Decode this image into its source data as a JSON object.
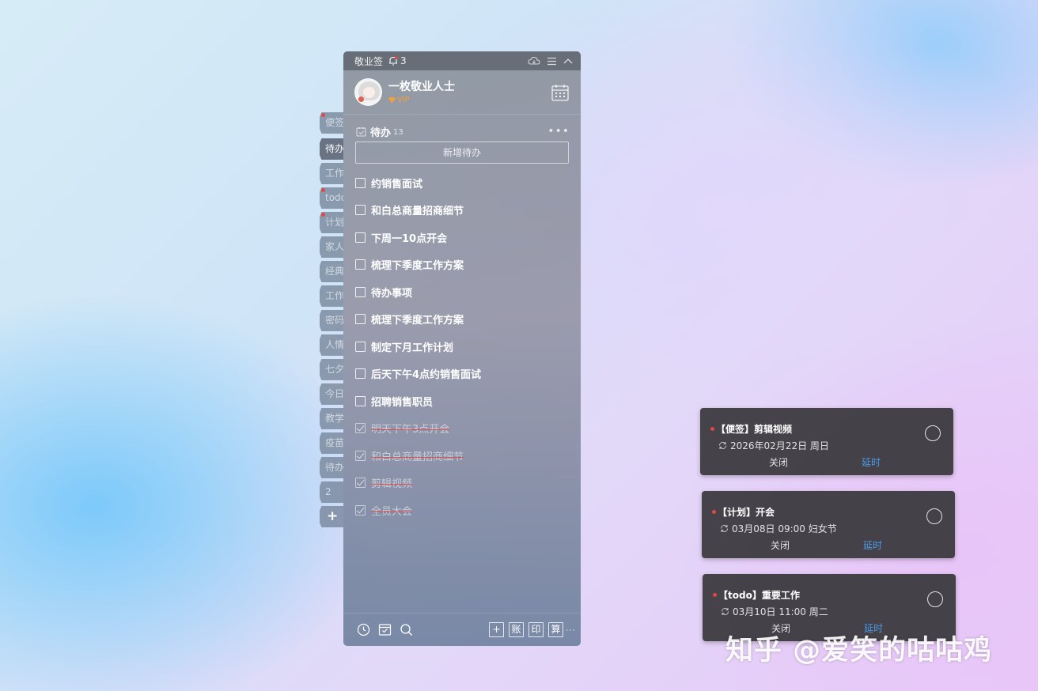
{
  "window": {
    "app_title": "敬业签",
    "reminder_count": "3"
  },
  "profile": {
    "name": "一枚敬业人士",
    "badge": "VIP"
  },
  "side_tabs": [
    {
      "label": "便签",
      "dot": true,
      "active": false
    },
    {
      "label": "待办",
      "dot": false,
      "active": true
    },
    {
      "label": "工作",
      "dot": false,
      "active": false
    },
    {
      "label": "todo",
      "dot": true,
      "active": false
    },
    {
      "label": "计划",
      "dot": true,
      "active": false
    },
    {
      "label": "家人",
      "dot": false,
      "active": false
    },
    {
      "label": "经典",
      "dot": false,
      "active": false
    },
    {
      "label": "工作",
      "dot": false,
      "active": false
    },
    {
      "label": "密码",
      "dot": false,
      "active": false
    },
    {
      "label": "人情",
      "dot": false,
      "active": false
    },
    {
      "label": "七夕",
      "dot": false,
      "active": false
    },
    {
      "label": "今日",
      "dot": false,
      "active": false
    },
    {
      "label": "教学",
      "dot": false,
      "active": false
    },
    {
      "label": "疫苗",
      "dot": false,
      "active": false
    },
    {
      "label": "待办",
      "dot": false,
      "active": false
    },
    {
      "label": "2",
      "dot": false,
      "active": false
    },
    {
      "label": "+",
      "dot": false,
      "active": false
    }
  ],
  "list": {
    "title": "待办",
    "count": "13",
    "add_button": "新增待办",
    "items": [
      {
        "text": "约销售面试",
        "done": false
      },
      {
        "text": "和白总商量招商细节",
        "done": false
      },
      {
        "text": "下周一10点开会",
        "done": false
      },
      {
        "text": "梳理下季度工作方案",
        "done": false
      },
      {
        "text": "待办事项",
        "done": false
      },
      {
        "text": "梳理下季度工作方案",
        "done": false
      },
      {
        "text": "制定下月工作计划",
        "done": false
      },
      {
        "text": "后天下午4点约销售面试",
        "done": false
      },
      {
        "text": "招聘销售职员",
        "done": false
      },
      {
        "text": "明天下午3点开会",
        "done": true
      },
      {
        "text": "和白总商量招商细节",
        "done": true
      },
      {
        "text": "剪辑视频",
        "done": true
      },
      {
        "text": "全员大会",
        "done": true
      }
    ]
  },
  "bottom_bar": {
    "btn_account": "账",
    "btn_print": "印",
    "btn_calc": "算"
  },
  "notifications": [
    {
      "title": "【便签】剪辑视频",
      "time": "2026年02月22日 周日",
      "close": "关闭",
      "delay": "延时"
    },
    {
      "title": "【计划】开会",
      "time": "03月08日 09:00 妇女节",
      "close": "关闭",
      "delay": "延时"
    },
    {
      "title": "【todo】重要工作",
      "time": "03月10日 11:00 周二",
      "close": "关闭",
      "delay": "延时"
    }
  ],
  "watermark": "知乎 @爱笑的咕咕鸡",
  "colors": {
    "accent_blue": "#4b9be6",
    "reminder_red": "#e04848",
    "vip_orange": "#f0a040"
  }
}
